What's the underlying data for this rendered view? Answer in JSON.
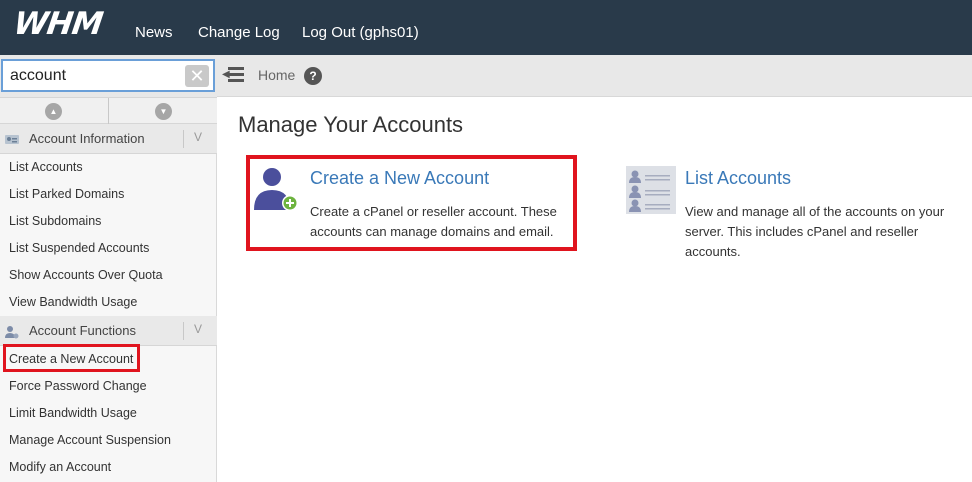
{
  "header": {
    "logo": "WHM",
    "nav": {
      "news": "News",
      "change_log": "Change Log",
      "log_out": "Log Out (gphs01)"
    }
  },
  "sidebar": {
    "search": {
      "value": "account",
      "clear_icon": "close-icon"
    },
    "groups": [
      {
        "label": "Account Information",
        "icon": "id-card-icon",
        "items": [
          "List Accounts",
          "List Parked Domains",
          "List Subdomains",
          "List Suspended Accounts",
          "Show Accounts Over Quota",
          "View Bandwidth Usage"
        ]
      },
      {
        "label": "Account Functions",
        "icon": "user-gear-icon",
        "items": [
          "Create a New Account",
          "Force Password Change",
          "Limit Bandwidth Usage",
          "Manage Account Suspension",
          "Modify an Account"
        ]
      }
    ]
  },
  "breadcrumb": {
    "home": "Home"
  },
  "main": {
    "title": "Manage Your Accounts",
    "cards": [
      {
        "title": "Create a New Account",
        "description": "Create a cPanel or reseller account. These accounts can manage domains and email.",
        "icon": "add-user-icon"
      },
      {
        "title": "List Accounts",
        "description": "View and manage all of the accounts on your server. This includes cPanel and reseller accounts.",
        "icon": "user-list-icon"
      }
    ]
  },
  "colors": {
    "topbar": "#293a4a",
    "link_blue": "#3a79b8",
    "highlight_red": "#e0141e",
    "icon_purple": "#4b4f9c",
    "icon_green": "#6db33f"
  }
}
